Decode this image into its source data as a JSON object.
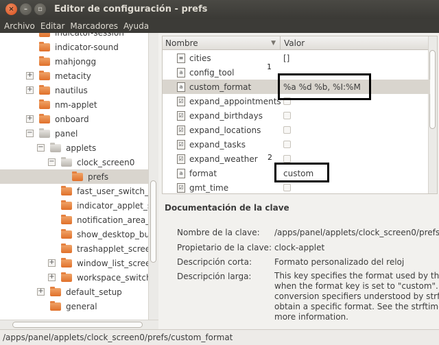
{
  "window": {
    "title": "Editor de configuración - prefs",
    "close_glyph": "×",
    "minimize_glyph": "–",
    "maximize_glyph": "▫"
  },
  "menu": [
    "Archivo",
    "Editar",
    "Marcadores",
    "Ayuda"
  ],
  "tree": {
    "items": [
      {
        "label": "indicator-session",
        "expander": "",
        "folder": "closed"
      },
      {
        "label": "indicator-sound",
        "expander": "",
        "folder": "closed"
      },
      {
        "label": "mahjongg",
        "expander": "",
        "folder": "closed"
      },
      {
        "label": "metacity",
        "expander": "+",
        "folder": "closed"
      },
      {
        "label": "nautilus",
        "expander": "+",
        "folder": "closed"
      },
      {
        "label": "nm-applet",
        "expander": "",
        "folder": "closed"
      },
      {
        "label": "onboard",
        "expander": "+",
        "folder": "closed"
      },
      {
        "label": "panel",
        "expander": "−",
        "folder": "open"
      },
      {
        "label": "applets",
        "expander": "−",
        "folder": "open"
      },
      {
        "label": "clock_screen0",
        "expander": "−",
        "folder": "open"
      },
      {
        "label": "prefs",
        "expander": "",
        "folder": "closed",
        "selected": true
      },
      {
        "label": "fast_user_switch_",
        "expander": "",
        "folder": "closed"
      },
      {
        "label": "indicator_applet_s",
        "expander": "",
        "folder": "closed"
      },
      {
        "label": "notification_area_",
        "expander": "",
        "folder": "closed"
      },
      {
        "label": "show_desktop_bu",
        "expander": "",
        "folder": "closed"
      },
      {
        "label": "trashapplet_scree",
        "expander": "",
        "folder": "closed"
      },
      {
        "label": "window_list_scree",
        "expander": "+",
        "folder": "closed"
      },
      {
        "label": "workspace_switch",
        "expander": "+",
        "folder": "closed"
      },
      {
        "label": "default_setup",
        "expander": "+",
        "folder": "closed"
      },
      {
        "label": "general",
        "expander": "",
        "folder": "closed"
      }
    ]
  },
  "keys": {
    "header_name": "Nombre",
    "header_value": "Valor",
    "rows": [
      {
        "name": "cities",
        "type": "list",
        "value": "[]"
      },
      {
        "name": "config_tool",
        "type": "string",
        "value": ""
      },
      {
        "name": "custom_format",
        "type": "string",
        "value": "%a %d %b, %I:%M",
        "selected": true
      },
      {
        "name": "expand_appointments",
        "type": "bool",
        "value": ""
      },
      {
        "name": "expand_birthdays",
        "type": "bool",
        "value": ""
      },
      {
        "name": "expand_locations",
        "type": "bool",
        "value": ""
      },
      {
        "name": "expand_tasks",
        "type": "bool",
        "value": ""
      },
      {
        "name": "expand_weather",
        "type": "bool",
        "value": ""
      },
      {
        "name": "format",
        "type": "string",
        "value": "custom"
      },
      {
        "name": "gmt_time",
        "type": "bool",
        "value": ""
      }
    ],
    "annotations": [
      "1",
      "2"
    ]
  },
  "docs": {
    "title": "Documentación de la clave",
    "key_name_label": "Nombre de la clave:",
    "key_name_value": "/apps/panel/applets/clock_screen0/prefs/",
    "owner_label": "Propietario de la clave:",
    "owner_value": "clock-applet",
    "short_desc_label": "Descripción corta:",
    "short_desc_value": "Formato personalizado del reloj",
    "long_desc_label": "Descripción larga:",
    "long_desc_lines": [
      "This key specifies the format used by th",
      "when the format key is set to \"custom\".",
      "conversion specifiers understood by strf",
      "obtain a specific format. See the strftime",
      "more information."
    ]
  },
  "status": {
    "path": "/apps/panel/applets/clock_screen0/prefs/custom_format"
  }
}
